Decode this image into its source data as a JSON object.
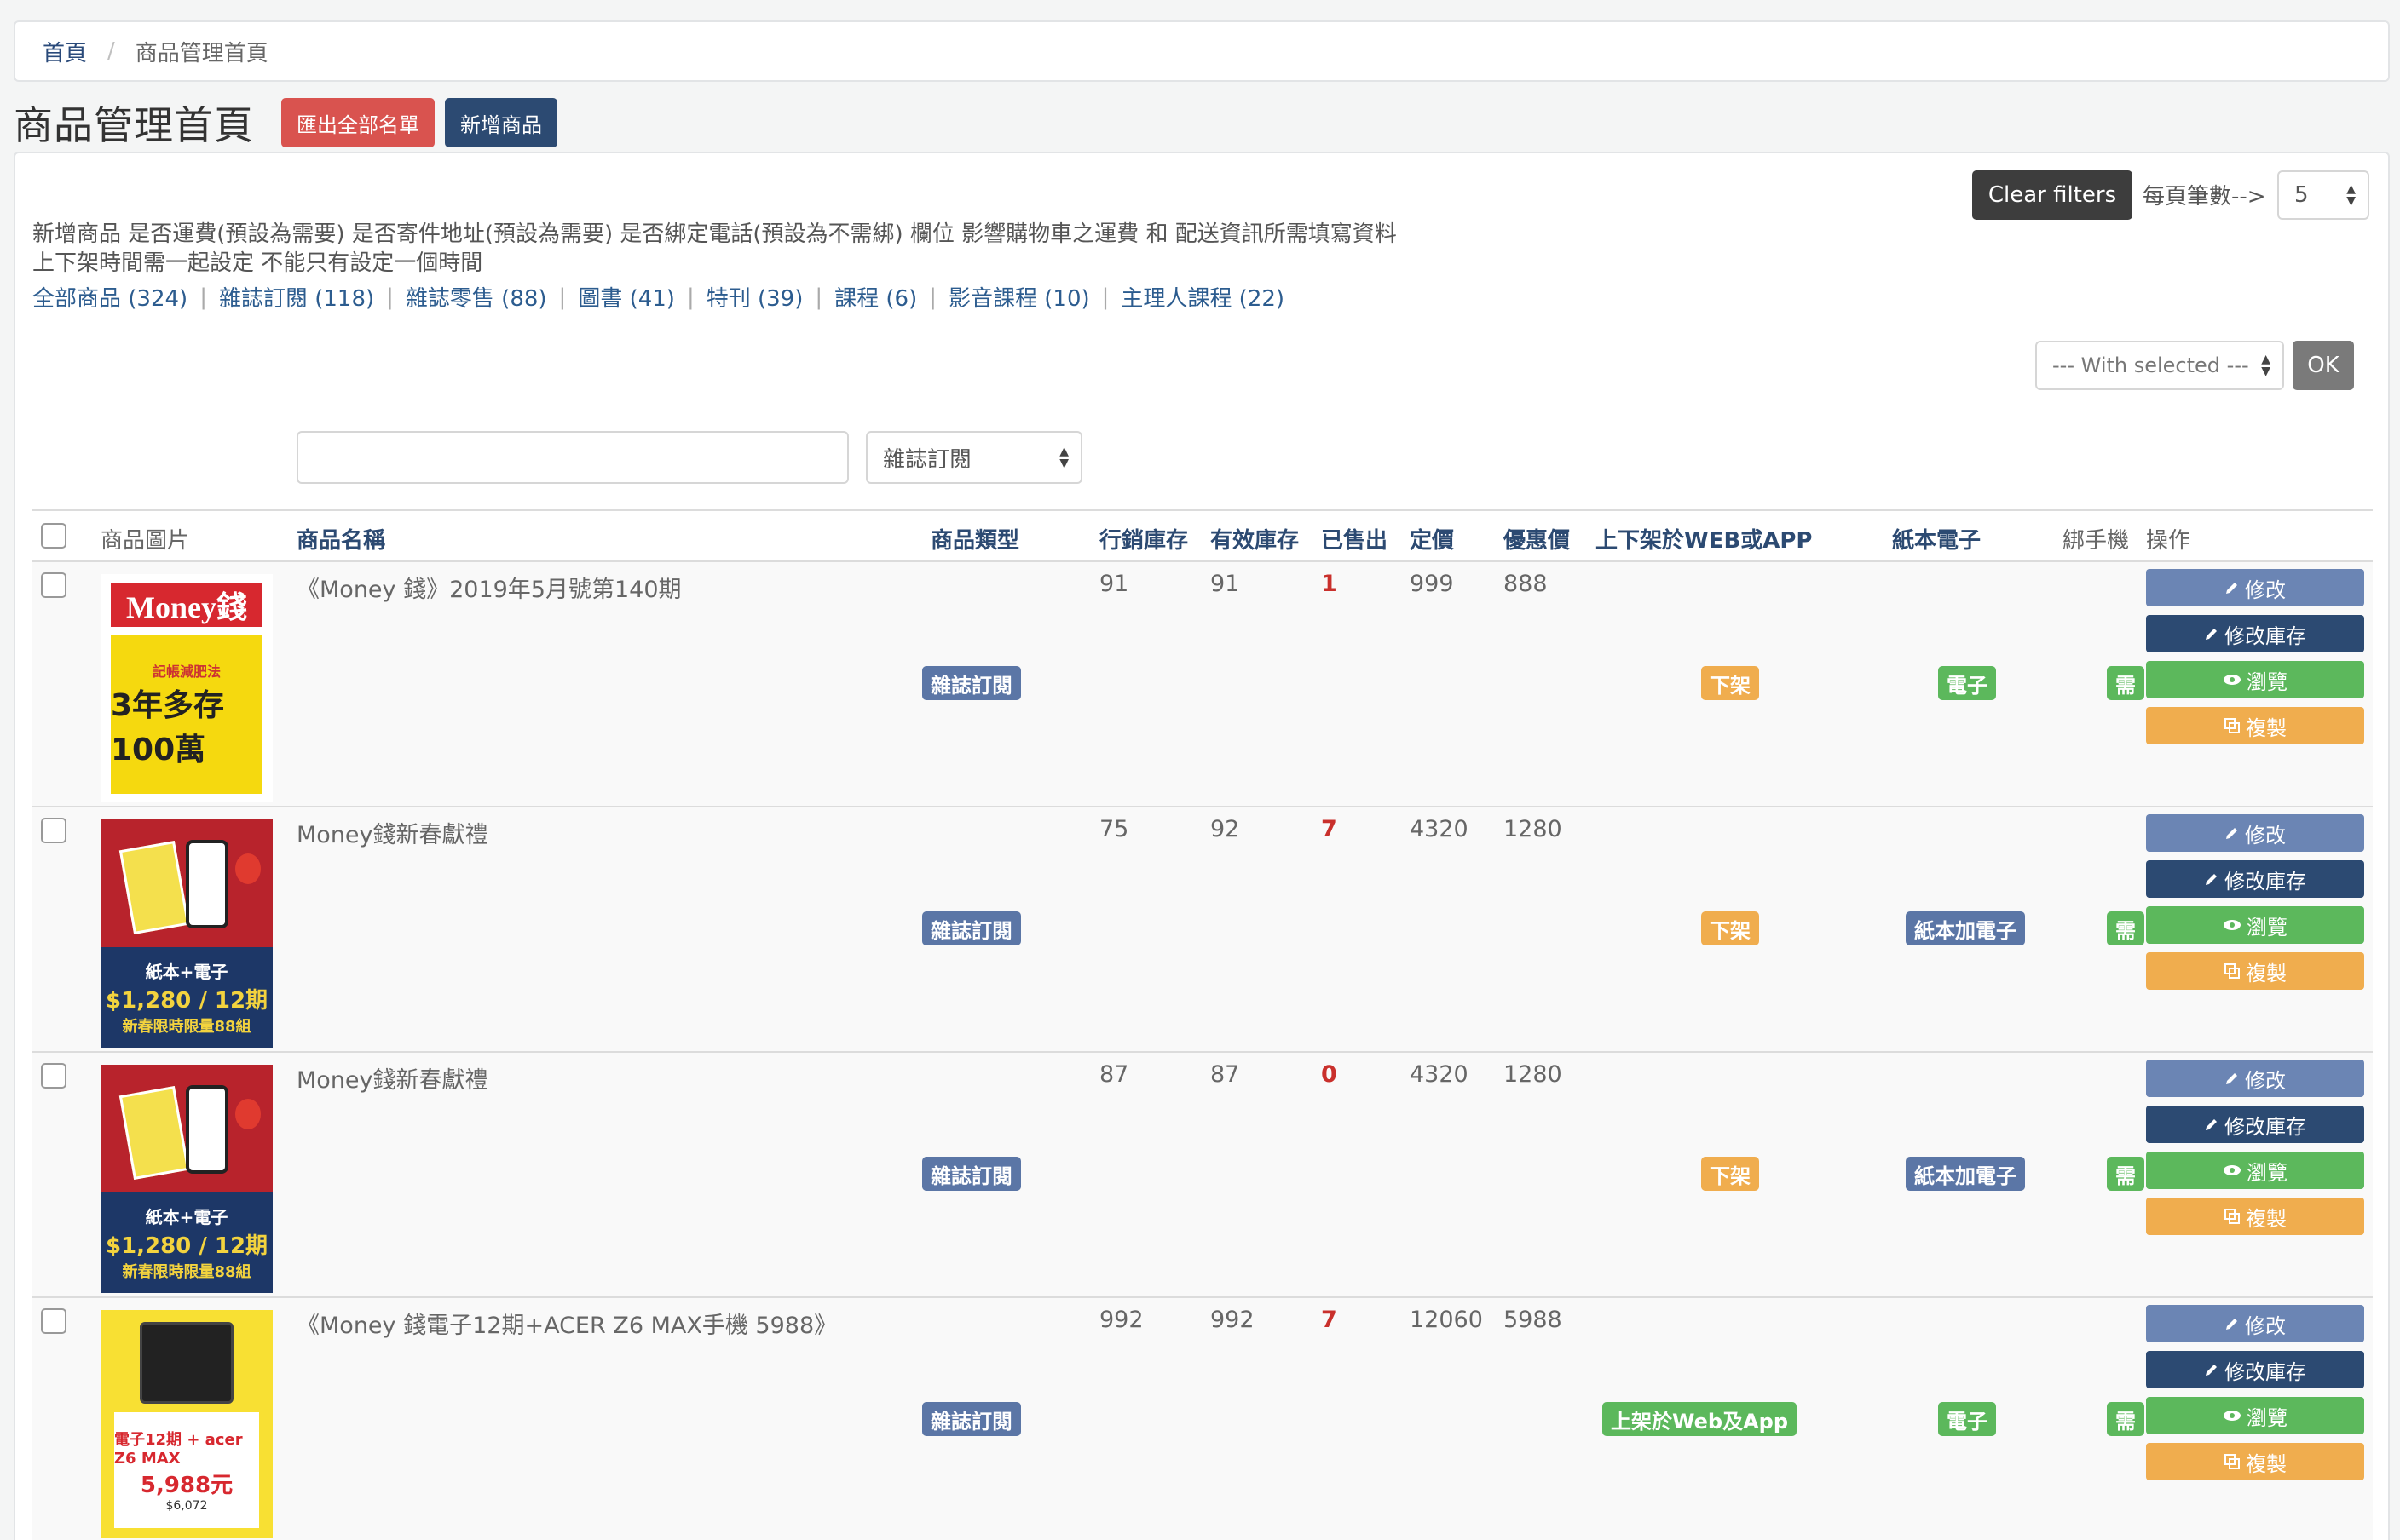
{
  "breadcrumb": {
    "home": "首頁",
    "separator": "/",
    "current": "商品管理首頁"
  },
  "header": {
    "title": "商品管理首頁",
    "export_label": "匯出全部名單",
    "add_label": "新增商品"
  },
  "toolbar": {
    "clear_filters": "Clear filters",
    "per_page_label": "每頁筆數-->",
    "per_page_value": "5",
    "with_selected": "--- With selected ---",
    "ok_label": "OK"
  },
  "notice": {
    "line1": "新增商品 是否運費(預設為需要) 是否寄件地址(預設為需要) 是否綁定電話(預設為不需綁) 欄位 影響購物車之運費 和 配送資訊所需填寫資料",
    "line2": "上下架時間需一起設定 不能只有設定一個時間"
  },
  "category_links": [
    "全部商品 (324)",
    "雜誌訂閱 (118)",
    "雜誌零售 (88)",
    "圖書 (41)",
    "特刊 (39)",
    "課程 (6)",
    "影音課程 (10)",
    "主理人課程 (22)"
  ],
  "search": {
    "value": "",
    "type_filter": "雜誌訂閱"
  },
  "columns": {
    "image": "商品圖片",
    "name": "商品名稱",
    "type": "商品類型",
    "marketing_stock": "行銷庫存",
    "effective_stock": "有效庫存",
    "sold": "已售出",
    "price": "定價",
    "sale_price": "優惠價",
    "listing": "上下架於WEB或APP",
    "format": "紙本電子",
    "phone": "綁手機",
    "actions": "操作"
  },
  "actions": {
    "edit": "修改",
    "edit_stock": "修改庫存",
    "view": "瀏覽",
    "copy": "複製"
  },
  "rows": [
    {
      "name": "《Money 錢》2019年5月號第140期",
      "type": "雜誌訂閱",
      "marketing_stock": "91",
      "effective_stock": "91",
      "sold": "1",
      "price": "999",
      "sale_price": "888",
      "listing": "下架",
      "format": "電子",
      "phone": "需",
      "cover": {
        "logo": "Money錢",
        "headline": "3年多存100萬",
        "sub": "記帳減肥法"
      }
    },
    {
      "name": "Money錢新春獻禮",
      "type": "雜誌訂閱",
      "marketing_stock": "75",
      "effective_stock": "92",
      "sold": "7",
      "price": "4320",
      "sale_price": "1280",
      "listing": "下架",
      "format": "紙本加電子",
      "phone": "需",
      "cover": {
        "l1": "紙本+電子",
        "l2": "$1,280 / 12期",
        "l3": "新春限時限量88組"
      }
    },
    {
      "name": "Money錢新春獻禮",
      "type": "雜誌訂閱",
      "marketing_stock": "87",
      "effective_stock": "87",
      "sold": "0",
      "price": "4320",
      "sale_price": "1280",
      "listing": "下架",
      "format": "紙本加電子",
      "phone": "需",
      "cover": {
        "l1": "紙本+電子",
        "l2": "$1,280 / 12期",
        "l3": "新春限時限量88組"
      }
    },
    {
      "name": "《Money 錢電子12期+ACER Z6 MAX手機 5988》",
      "type": "雜誌訂閱",
      "marketing_stock": "992",
      "effective_stock": "992",
      "sold": "7",
      "price": "12060",
      "sale_price": "5988",
      "listing": "上架於Web及App",
      "format": "電子",
      "phone": "需",
      "cover": {
        "t1": "電子12期 + acer Z6 MAX",
        "t2": "5,988元",
        "t3": "$6,072"
      }
    }
  ],
  "colors": {
    "navy": "#2c4a72",
    "red": "#d9534f",
    "orange": "#f0ad4e",
    "green": "#5cb85c",
    "slate": "#5b76a6",
    "sold_red": "#c9302c"
  }
}
